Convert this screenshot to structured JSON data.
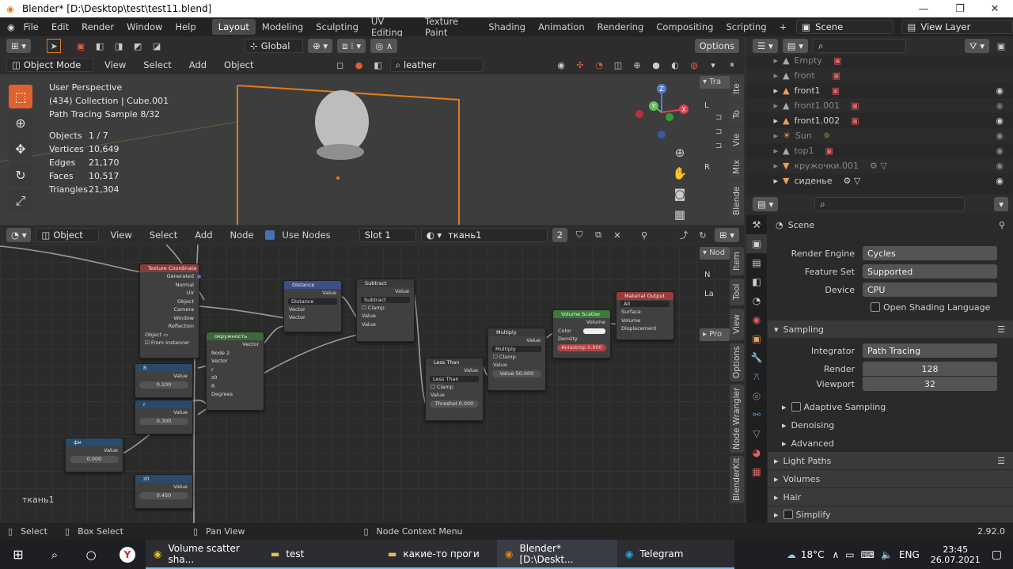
{
  "window": {
    "title": "Blender* [D:\\Desktop\\test\\test11.blend]",
    "minimize": "—",
    "maximize": "❐",
    "close": "✕"
  },
  "menu": {
    "items": [
      "File",
      "Edit",
      "Render",
      "Window",
      "Help"
    ]
  },
  "workspaces": {
    "tabs": [
      "Layout",
      "Modeling",
      "Sculpting",
      "UV Editing",
      "Texture Paint",
      "Shading",
      "Animation",
      "Rendering",
      "Compositing",
      "Scripting"
    ],
    "active": "Layout",
    "add": "+"
  },
  "scene": {
    "scene_label": "Scene",
    "view_layer_label": "View Layer"
  },
  "viewport_header": {
    "transform": "Global",
    "options": "Options",
    "search": "leather",
    "mode": "Object Mode",
    "menus": [
      "View",
      "Select",
      "Add",
      "Object"
    ]
  },
  "viewport": {
    "info": [
      "User Perspective",
      "(434) Collection | Cube.001",
      "Path Tracing Sample 8/32"
    ],
    "stats": [
      {
        "k": "Objects",
        "v": "1 / 7"
      },
      {
        "k": "Vertices",
        "v": "10,649"
      },
      {
        "k": "Edges",
        "v": "21,170"
      },
      {
        "k": "Faces",
        "v": "10,517"
      },
      {
        "k": "Triangles",
        "v": "21,304"
      }
    ],
    "side_tabs": [
      "Ite",
      "To",
      "Vie",
      "Mix",
      "Blende"
    ],
    "n_panel": {
      "tab": "Tra",
      "l1": "L",
      "l2": "R"
    },
    "gizmo": {
      "z": "Z",
      "y": "Y",
      "x": "X"
    }
  },
  "node_header": {
    "type": "Object",
    "menus": [
      "View",
      "Select",
      "Add",
      "Node"
    ],
    "use_nodes": "Use Nodes",
    "slot": "Slot 1",
    "material": "ткань1",
    "users": "2"
  },
  "node_editor": {
    "label": "ткань1",
    "side_tabs": [
      "Item",
      "Tool",
      "View",
      "Options",
      "Node Wrangler",
      "BlenderKit"
    ],
    "n_panel": {
      "tab": "Nod",
      "n": "N",
      "la": "La",
      "pro": "Pro"
    }
  },
  "nodes": {
    "texcoord": {
      "title": "Texture Coordinate",
      "outputs": [
        "Generated",
        "Normal",
        "UV",
        "Object",
        "Camera",
        "Window",
        "Reflection"
      ],
      "object": "Object",
      "from_instancer": "From Instancer"
    },
    "circle": {
      "title": "окружность",
      "out": "Vector",
      "node": "Node",
      "num": "2",
      "inputs": [
        "Vector",
        "r",
        "z0",
        "R",
        "Degrees"
      ]
    },
    "R": {
      "title": "R",
      "out": "Value",
      "val": "0.100"
    },
    "r": {
      "title": "r",
      "out": "Value",
      "val": "0.300"
    },
    "fi": {
      "title": "фи",
      "out": "Value",
      "val": "0.000"
    },
    "z0": {
      "title": "z0",
      "out": "Value",
      "val": "0.450"
    },
    "distance": {
      "title": "Distance",
      "out": "Value",
      "op": "Distance",
      "inputs": [
        "Vector",
        "Vector"
      ]
    },
    "subtract": {
      "title": "Subtract",
      "out": "Value",
      "op": "Subtract",
      "clamp": "Clamp",
      "inputs": [
        "Value",
        "Value"
      ]
    },
    "lessthan": {
      "title": "Less Than",
      "out": "Value",
      "op": "Less Than",
      "clamp": "Clamp",
      "inputs": [
        "Value"
      ],
      "threshold": "Threshol 0.000"
    },
    "multiply": {
      "title": "Multiply",
      "out": "Value",
      "op": "Multiply",
      "clamp": "Clamp",
      "inputs": [
        "Value"
      ],
      "val": "Value       50.000"
    },
    "volscatter": {
      "title": "Volume Scatter",
      "out": "Volume",
      "inputs": [
        "Color",
        "Density"
      ],
      "anis": "Anisotrop 0.000"
    },
    "matout": {
      "title": "Material Output",
      "target": "All",
      "inputs": [
        "Surface",
        "Volume",
        "Displacement"
      ]
    }
  },
  "outliner": {
    "rows": [
      "Empty",
      "front",
      "front1",
      "front1.001",
      "front1.002",
      "Sun",
      "top1",
      "кружочки.001",
      "сиденье"
    ]
  },
  "properties": {
    "title": "Scene",
    "render_engine_label": "Render Engine",
    "render_engine": "Cycles",
    "feature_set_label": "Feature Set",
    "feature_set": "Supported",
    "device_label": "Device",
    "device": "CPU",
    "osl": "Open Shading Language",
    "sampling": "Sampling",
    "integrator_label": "Integrator",
    "integrator": "Path Tracing",
    "render_label": "Render",
    "render": "128",
    "viewport_label": "Viewport",
    "viewport": "32",
    "adaptive": "Adaptive Sampling",
    "denoising": "Denoising",
    "advanced": "Advanced",
    "sections": [
      "Light Paths",
      "Volumes",
      "Hair",
      "Simplify"
    ]
  },
  "status": {
    "select": "Select",
    "box_select": "Box Select",
    "pan_view": "Pan View",
    "node_menu": "Node Context Menu",
    "version": "2.92.0"
  },
  "taskbar": {
    "apps": [
      "Volume scatter sha...",
      "test",
      "какие-то проги",
      "Blender* [D:\\Deskt...",
      "Telegram"
    ],
    "temp": "18°C",
    "lang": "ENG",
    "time": "23:45",
    "date": "26.07.2021"
  },
  "colors": {
    "accent": "#e57a17",
    "active_tool": "#e06030",
    "select_blue": "#4772b3"
  }
}
